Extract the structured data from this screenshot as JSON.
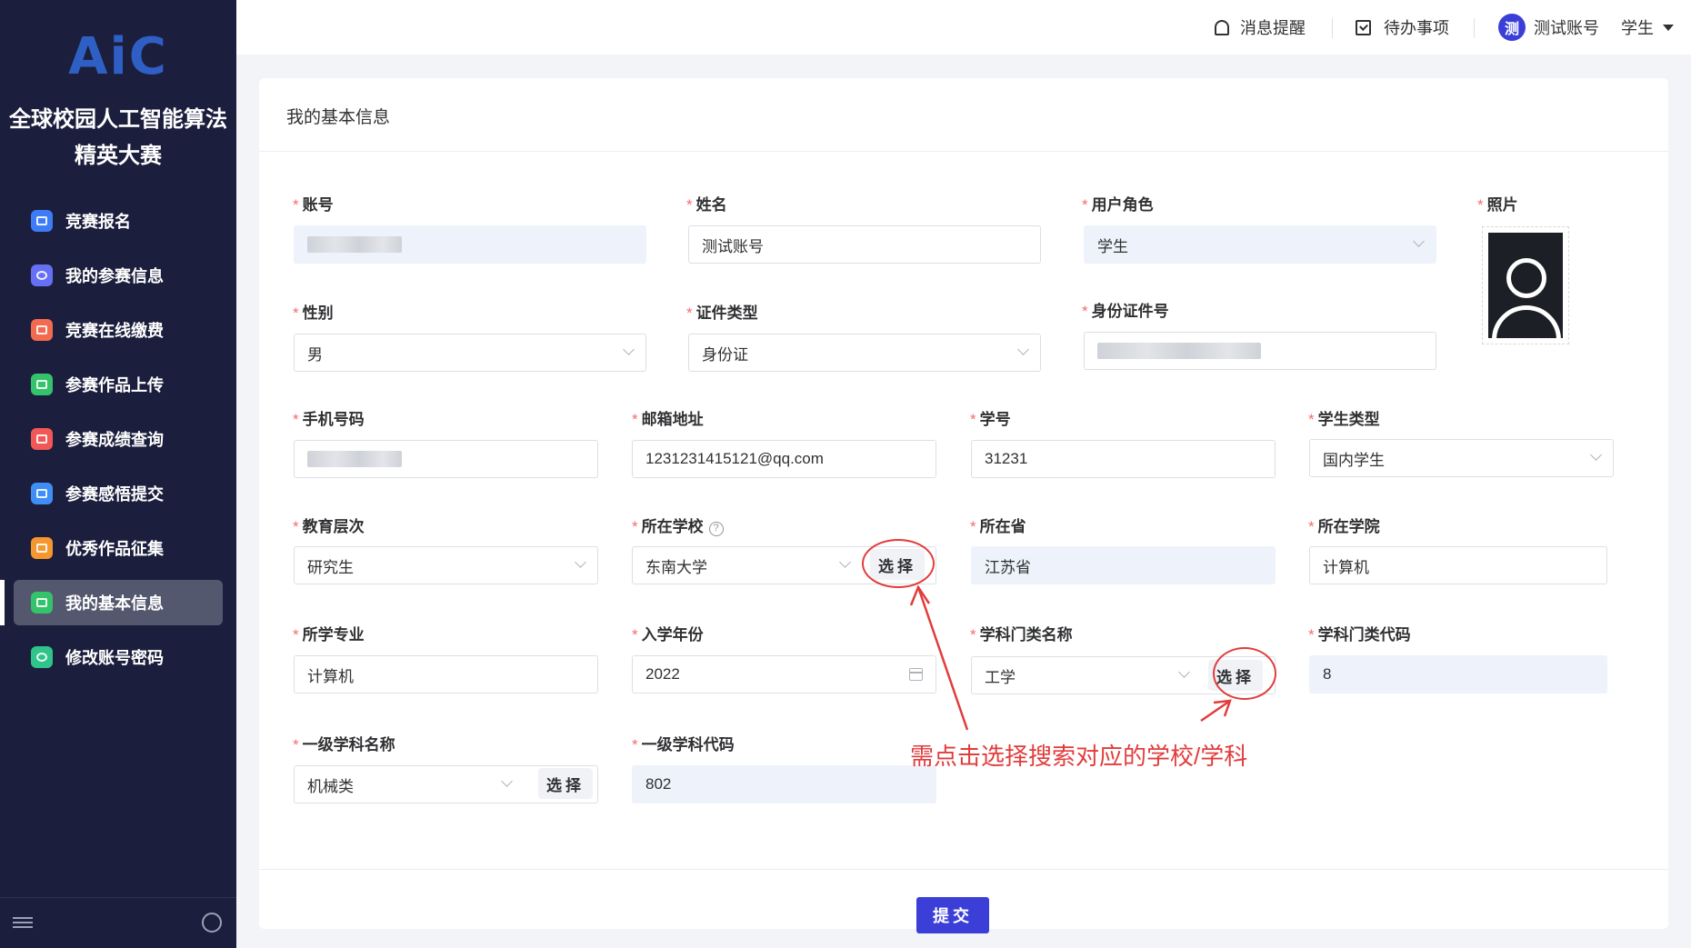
{
  "sidebar": {
    "logo": "AiC",
    "brand": "全球校园人工智能算法精英大赛",
    "items": [
      {
        "label": "竞赛报名",
        "icon": "registration-icon",
        "color": "#3d7cf5"
      },
      {
        "label": "我的参赛信息",
        "icon": "globe-icon",
        "color": "#6670f5"
      },
      {
        "label": "竞赛在线缴费",
        "icon": "payment-icon",
        "color": "#f26b4f"
      },
      {
        "label": "参赛作品上传",
        "icon": "upload-icon",
        "color": "#34c36a"
      },
      {
        "label": "参赛成绩查询",
        "icon": "score-icon",
        "color": "#f25757"
      },
      {
        "label": "参赛感悟提交",
        "icon": "feedback-icon",
        "color": "#3f8ef5"
      },
      {
        "label": "优秀作品征集",
        "icon": "collection-icon",
        "color": "#f6962f"
      },
      {
        "label": "我的基本信息",
        "icon": "profile-icon",
        "color": "#34c36a",
        "active": true
      },
      {
        "label": "修改账号密码",
        "icon": "settings-icon",
        "color": "#2fc48a"
      }
    ]
  },
  "topbar": {
    "notifications": "消息提醒",
    "todo": "待办事项",
    "avatar_char": "测",
    "account": "测试账号",
    "role": "学生"
  },
  "form": {
    "title": "我的基本信息",
    "photo_label": "照片",
    "account_label": "账号",
    "name_label": "姓名",
    "name_value": "测试账号",
    "role_label": "用户角色",
    "role_value": "学生",
    "gender_label": "性别",
    "gender_value": "男",
    "idtype_label": "证件类型",
    "idtype_value": "身份证",
    "idno_label": "身份证件号",
    "phone_label": "手机号码",
    "email_label": "邮箱地址",
    "email_value": "1231231415121@qq.com",
    "sid_label": "学号",
    "sid_value": "31231",
    "stype_label": "学生类型",
    "stype_value": "国内学生",
    "edu_label": "教育层次",
    "edu_value": "研究生",
    "school_label": "所在学校",
    "school_value": "东南大学",
    "province_label": "所在省",
    "province_value": "江苏省",
    "college_label": "所在学院",
    "college_value": "计算机",
    "major_label": "所学专业",
    "major_value": "计算机",
    "year_label": "入学年份",
    "year_value": "2022",
    "cat_label": "学科门类名称",
    "cat_value": "工学",
    "catcode_label": "学科门类代码",
    "catcode_value": "8",
    "sub_label": "一级学科名称",
    "sub_value": "机械类",
    "subcode_label": "一级学科代码",
    "subcode_value": "802",
    "select_label": "选择",
    "submit_label": "提交"
  },
  "annotation": {
    "text": "需点击选择搜索对应的学校/学科",
    "color": "#e23c3c"
  }
}
